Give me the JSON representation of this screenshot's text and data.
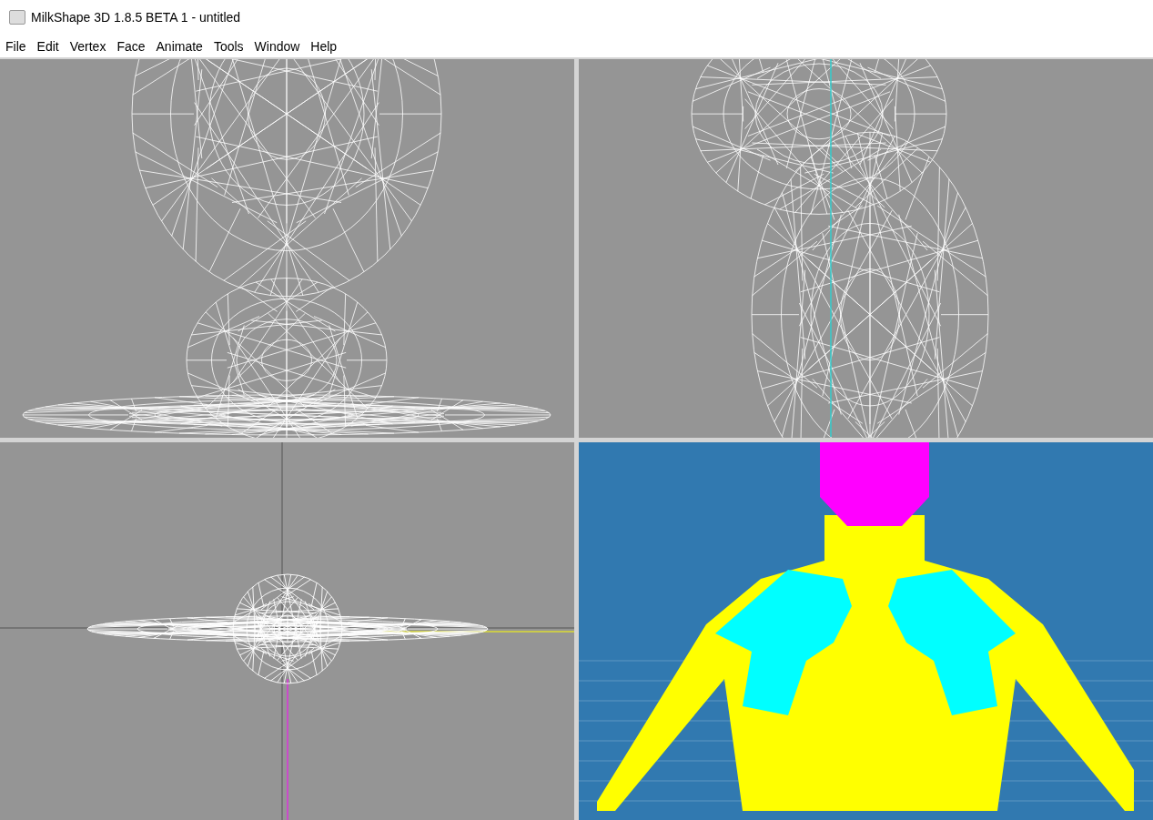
{
  "window": {
    "title": "MilkShape 3D 1.8.5 BETA 1 - untitled"
  },
  "menu": [
    "File",
    "Edit",
    "Vertex",
    "Face",
    "Animate",
    "Tools",
    "Window",
    "Help"
  ],
  "viewports": [
    {
      "kind": "front"
    },
    {
      "kind": "side"
    },
    {
      "kind": "top"
    },
    {
      "kind": "shaded"
    }
  ]
}
